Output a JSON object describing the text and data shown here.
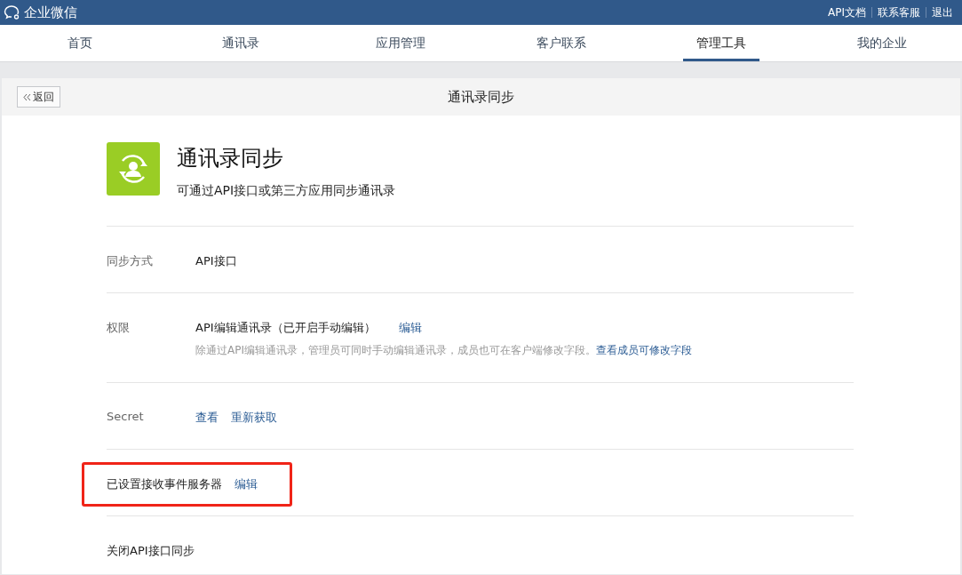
{
  "brand": "企业微信",
  "top_links": [
    "API文档",
    "联系客服",
    "退出"
  ],
  "nav": [
    {
      "label": "首页",
      "selected": false
    },
    {
      "label": "通讯录",
      "selected": false
    },
    {
      "label": "应用管理",
      "selected": false
    },
    {
      "label": "客户联系",
      "selected": false
    },
    {
      "label": "管理工具",
      "selected": true
    },
    {
      "label": "我的企业",
      "selected": false
    }
  ],
  "panel": {
    "back": "返回",
    "title": "通讯录同步"
  },
  "app": {
    "title": "通讯录同步",
    "subtitle": "可通过API接口或第三方应用同步通讯录"
  },
  "rows": [
    {
      "kind": "field",
      "label": "同步方式",
      "value": "API接口"
    },
    {
      "kind": "permission",
      "label": "权限",
      "value": "API编辑通讯录（已开启手动编辑）",
      "action": "编辑",
      "note": "除通过API编辑通讯录，管理员可同时手动编辑通讯录，成员也可在客户端修改字段。",
      "note_link": "查看成员可修改字段"
    },
    {
      "kind": "links",
      "label": "Secret",
      "links": [
        "查看",
        "重新获取"
      ]
    },
    {
      "kind": "status",
      "text": "已设置接收事件服务器",
      "action": "编辑",
      "highlighted": true
    },
    {
      "kind": "plain",
      "text": "关闭API接口同步"
    }
  ]
}
